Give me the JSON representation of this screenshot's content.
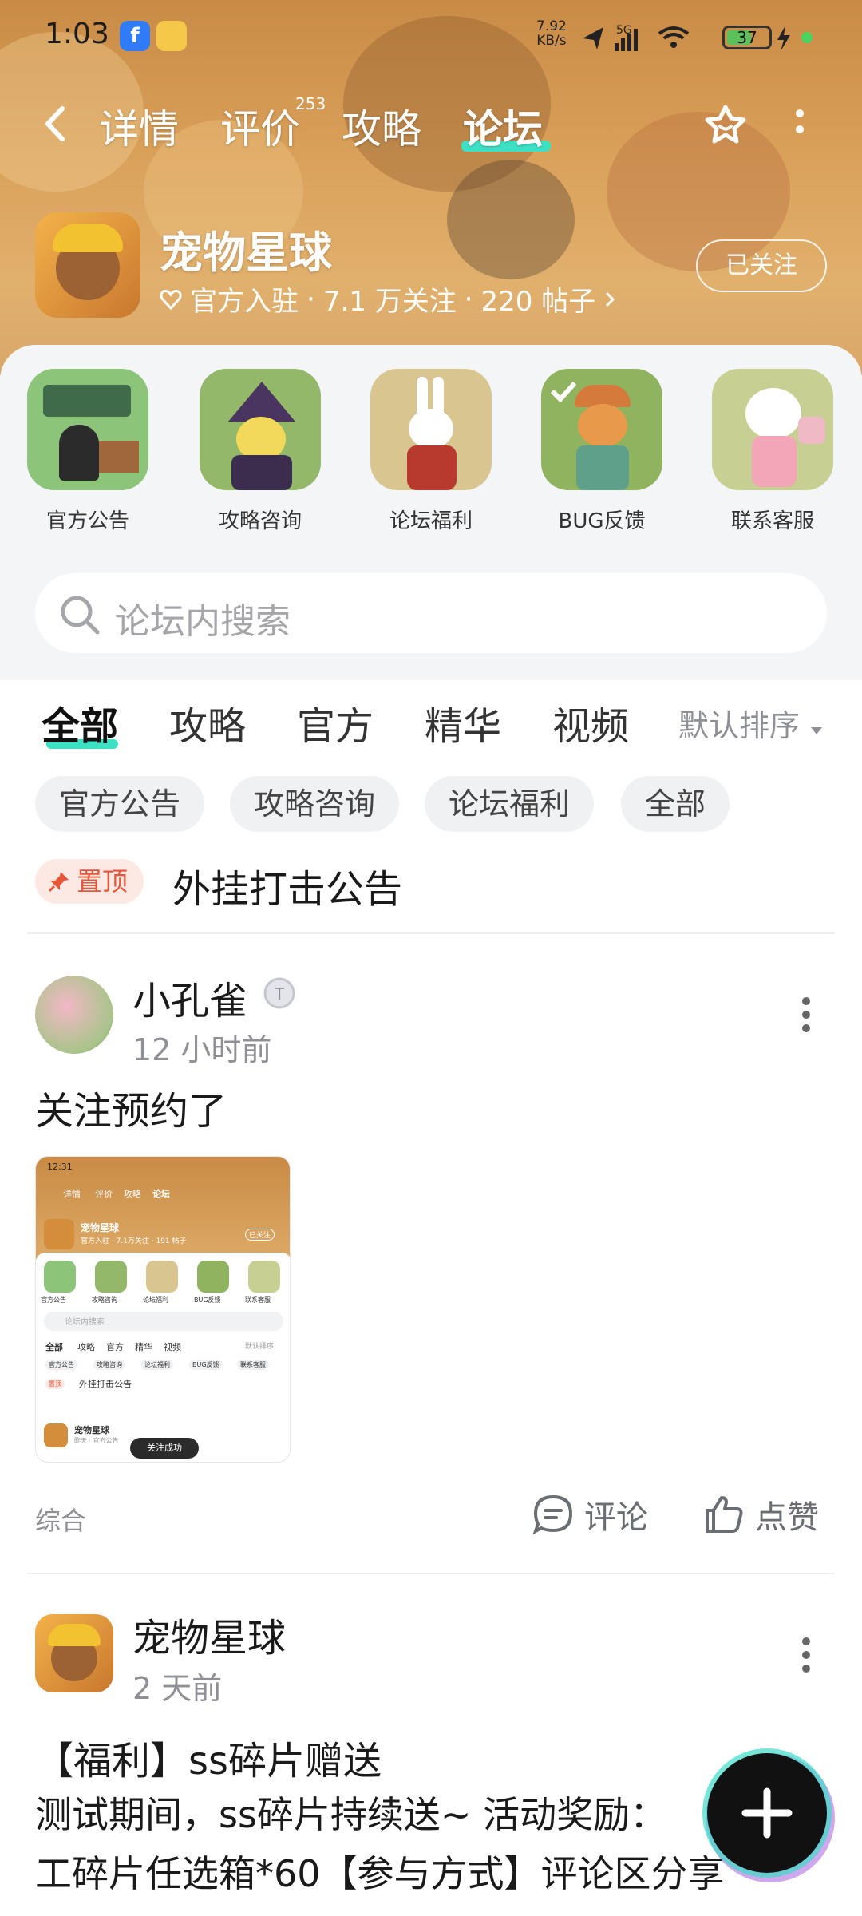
{
  "status_bar": {
    "time": "1:03",
    "net_speed_value": "7.92",
    "net_speed_unit": "KB/s",
    "network": "5G",
    "battery": "37"
  },
  "nav": {
    "tabs": [
      {
        "label": "详情"
      },
      {
        "label": "评价",
        "badge": "253"
      },
      {
        "label": "攻略"
      },
      {
        "label": "论坛",
        "active": true
      }
    ]
  },
  "app": {
    "name": "宠物星球",
    "official": "官方入驻",
    "followers": "7.1 万关注",
    "posts": "220 帖子",
    "follow_button": "已关注"
  },
  "categories": [
    {
      "label": "官方公告",
      "color": "#8cc47a"
    },
    {
      "label": "攻略咨询",
      "color": "#93b86a"
    },
    {
      "label": "论坛福利",
      "color": "#d9c58f"
    },
    {
      "label": "BUG反馈",
      "color": "#8fb35f"
    },
    {
      "label": "联系客服",
      "color": "#c7cf93"
    }
  ],
  "search": {
    "placeholder": "论坛内搜索"
  },
  "filter_tabs": [
    {
      "label": "全部",
      "active": true
    },
    {
      "label": "攻略"
    },
    {
      "label": "官方"
    },
    {
      "label": "精华"
    },
    {
      "label": "视频"
    }
  ],
  "sort_label": "默认排序",
  "chips": [
    "官方公告",
    "攻略咨询",
    "论坛福利",
    "全部"
  ],
  "pinned": {
    "badge": "置顶",
    "title": "外挂打击公告"
  },
  "post1": {
    "user": "小孔雀",
    "time": "12 小时前",
    "text": "关注预约了",
    "tag": "综合",
    "comment_label": "评论",
    "like_label": "点赞",
    "screenshot": {
      "time": "12:31",
      "tabs": [
        "详情",
        "评价",
        "攻略",
        "论坛"
      ],
      "name": "宠物星球",
      "meta": "官方入驻 · 7.1万关注 · 191 帖子",
      "follow": "已关注",
      "cats": [
        "官方公告",
        "攻略咨询",
        "论坛福利",
        "BUG反馈",
        "联系客服"
      ],
      "search": "论坛内搜索",
      "ftabs": [
        "全部",
        "攻略",
        "官方",
        "精华",
        "视频"
      ],
      "sort": "默认排序",
      "chips": [
        "官方公告",
        "攻略咨询",
        "论坛福利",
        "BUG反馈",
        "联系客服"
      ],
      "pinned": "置顶",
      "pinned_title": "外挂打击公告",
      "post_name": "宠物星球",
      "post_meta": "昨天 · 官方公告",
      "toast": "关注成功"
    }
  },
  "post2": {
    "user": "宠物星球",
    "time": "2 天前",
    "title": "【福利】ss碎片赠送",
    "body_line1": "测试期间，ss碎片持续送~ 活动奖励：",
    "body_line2": "工碎片任选箱*60【参与方式】评论区分享"
  },
  "colors": {
    "accent": "#3ee0c4",
    "pin": "#e8563a",
    "hero": "#d9a05a"
  }
}
